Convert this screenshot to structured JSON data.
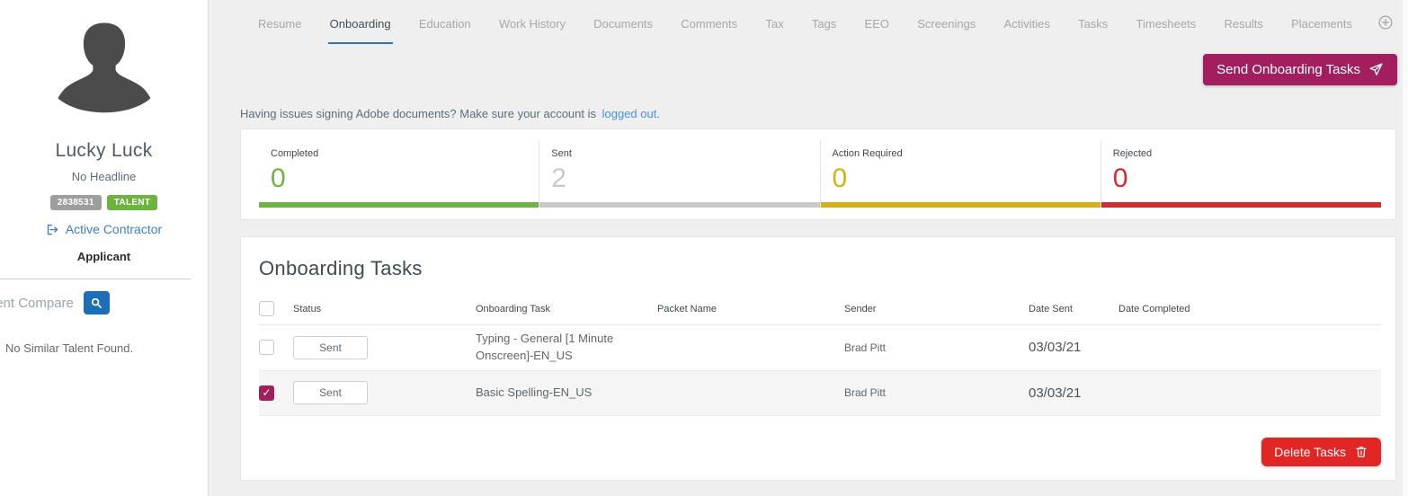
{
  "sidebar": {
    "name": "Lucky Luck",
    "headline": "No Headline",
    "id_badge": "2838531",
    "talent_badge": "TALENT",
    "status_link": "Active Contractor",
    "role": "Applicant",
    "compare_label": "Talent Compare",
    "no_similar_text": "No Similar Talent Found."
  },
  "tabs": {
    "items": [
      "Resume",
      "Onboarding",
      "Education",
      "Work History",
      "Documents",
      "Comments",
      "Tax",
      "Tags",
      "EEO",
      "Screenings",
      "Activities",
      "Tasks",
      "Timesheets",
      "Results",
      "Placements"
    ],
    "active": "Onboarding"
  },
  "toolbar": {
    "send_label": "Send Onboarding Tasks"
  },
  "notice": {
    "text": "Having issues signing Adobe documents? Make sure your account is",
    "link_label": "logged out."
  },
  "stats": [
    {
      "label": "Completed",
      "value": "0",
      "color": "#6fb244"
    },
    {
      "label": "Sent",
      "value": "2",
      "color": "#c9c9c9"
    },
    {
      "label": "Action Required",
      "value": "0",
      "color": "#d3b117"
    },
    {
      "label": "Rejected",
      "value": "0",
      "color": "#d22b31"
    }
  ],
  "tasks": {
    "title": "Onboarding Tasks",
    "columns": [
      "Status",
      "Onboarding Task",
      "Packet Name",
      "Sender",
      "Date Sent",
      "Date Completed"
    ],
    "rows": [
      {
        "checked": false,
        "status": "Sent",
        "task": "Typing - General [1 Minute Onscreen]-EN_US",
        "packet": "",
        "sender": "Brad Pitt",
        "date_sent": "03/03/21",
        "date_completed": ""
      },
      {
        "checked": true,
        "status": "Sent",
        "task": "Basic Spelling-EN_US",
        "packet": "",
        "sender": "Brad Pitt",
        "date_sent": "03/03/21",
        "date_completed": ""
      }
    ],
    "delete_label": "Delete Tasks"
  },
  "colors": {
    "accent_berry": "#a21e5e",
    "accent_red": "#e12726",
    "tab_underline_blue": "#2c75b5",
    "link_blue": "#4a90d9",
    "badge_green": "#6cb33f",
    "badge_gray": "#9e9e9e",
    "background": "#f0efef"
  }
}
